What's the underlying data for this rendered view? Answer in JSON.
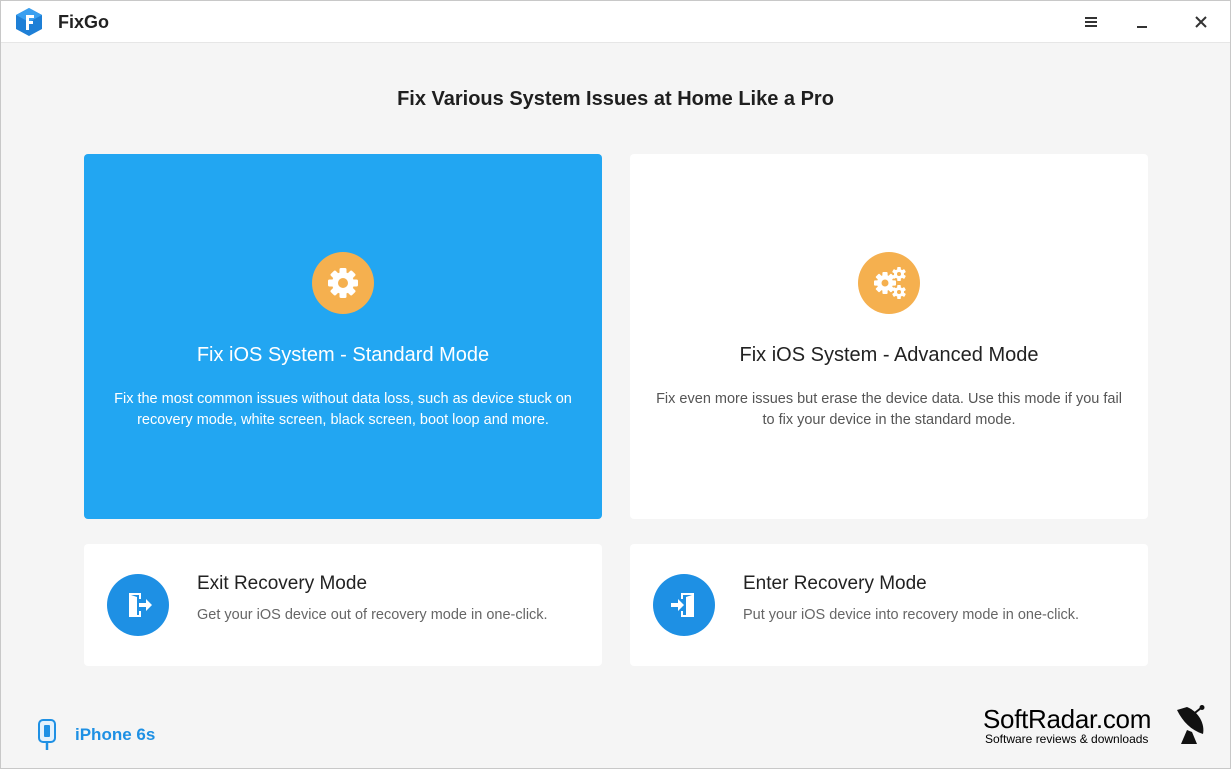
{
  "app": {
    "title": "FixGo"
  },
  "headline": "Fix Various System Issues at Home Like a Pro",
  "modes": {
    "standard": {
      "title": "Fix iOS System - Standard Mode",
      "description": "Fix the most common issues without data loss, such as device stuck on recovery mode, white screen, black screen, boot loop and more.",
      "icon": "gear-icon"
    },
    "advanced": {
      "title": "Fix iOS System - Advanced Mode",
      "description": "Fix even more issues but erase the device data. Use this mode if you fail to fix your device in the standard mode.",
      "icon": "gears-icon"
    }
  },
  "recovery": {
    "exit": {
      "title": "Exit Recovery Mode",
      "description": "Get your iOS device out of recovery mode in one-click.",
      "icon": "exit-door-icon"
    },
    "enter": {
      "title": "Enter Recovery Mode",
      "description": "Put your iOS device into recovery mode in one-click.",
      "icon": "enter-door-icon"
    }
  },
  "device": {
    "name": "iPhone 6s",
    "icon": "usb-cable-icon"
  },
  "watermark": {
    "name": "SoftRadar.com",
    "tagline": "Software reviews & downloads"
  },
  "colors": {
    "accent": "#22a6f2",
    "icon_orange": "#f5b04f",
    "icon_blue": "#1e90e4"
  }
}
